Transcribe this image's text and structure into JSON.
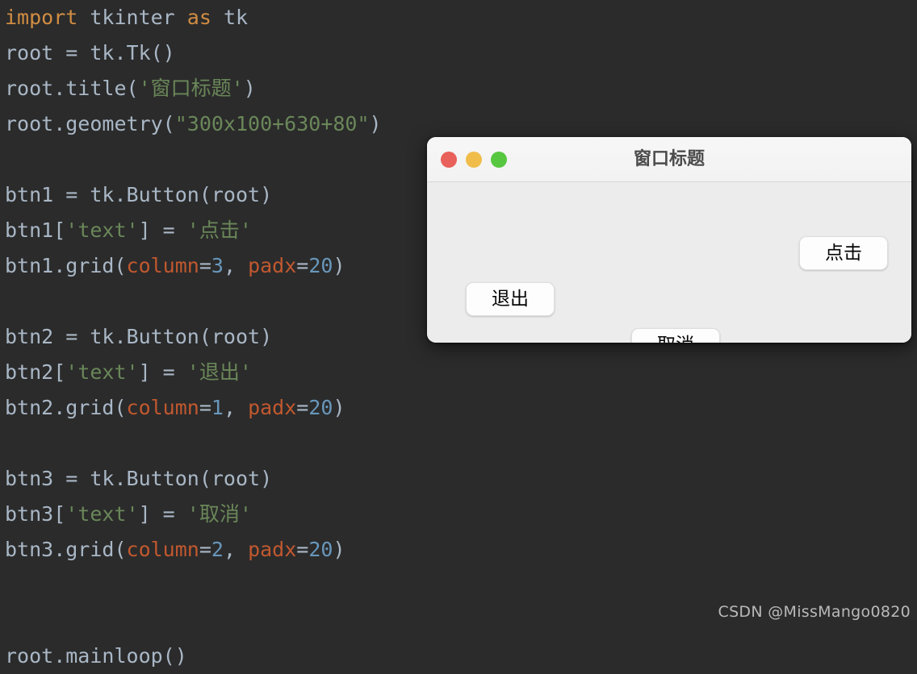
{
  "editor": {
    "background_color": "#2b2b2b",
    "default_text_color": "#a9b7c6",
    "keyword_color": "#d18d43",
    "string_color": "#6a8759",
    "kwarg_color": "#c1582f",
    "number_color": "#6897bb",
    "lines": [
      {
        "id": "l1",
        "parts": [
          {
            "t": "import",
            "c": "kw"
          },
          {
            "t": " tkinter ",
            "c": "plain"
          },
          {
            "t": "as",
            "c": "kw"
          },
          {
            "t": " tk",
            "c": "plain"
          }
        ]
      },
      {
        "id": "l2",
        "parts": [
          {
            "t": "root = tk.Tk()",
            "c": "plain"
          }
        ]
      },
      {
        "id": "l3",
        "parts": [
          {
            "t": "root.title(",
            "c": "plain"
          },
          {
            "t": "'窗口标题'",
            "c": "str"
          },
          {
            "t": ")",
            "c": "plain"
          }
        ]
      },
      {
        "id": "l4",
        "parts": [
          {
            "t": "root.geometry(",
            "c": "plain"
          },
          {
            "t": "\"300x100+630+80\"",
            "c": "str"
          },
          {
            "t": ")",
            "c": "plain"
          }
        ]
      },
      {
        "id": "l5",
        "parts": [
          {
            "t": "",
            "c": "plain"
          }
        ]
      },
      {
        "id": "l6",
        "parts": [
          {
            "t": "btn1 = tk.Button(root)",
            "c": "plain"
          }
        ]
      },
      {
        "id": "l7",
        "parts": [
          {
            "t": "btn1[",
            "c": "plain"
          },
          {
            "t": "'text'",
            "c": "str"
          },
          {
            "t": "] = ",
            "c": "plain"
          },
          {
            "t": "'点击'",
            "c": "str"
          }
        ]
      },
      {
        "id": "l8",
        "parts": [
          {
            "t": "btn1.grid(",
            "c": "plain"
          },
          {
            "t": "column",
            "c": "arg"
          },
          {
            "t": "=",
            "c": "plain"
          },
          {
            "t": "3",
            "c": "num"
          },
          {
            "t": ", ",
            "c": "plain"
          },
          {
            "t": "padx",
            "c": "arg"
          },
          {
            "t": "=",
            "c": "plain"
          },
          {
            "t": "20",
            "c": "num"
          },
          {
            "t": ")",
            "c": "plain"
          }
        ]
      },
      {
        "id": "l9",
        "parts": [
          {
            "t": "",
            "c": "plain"
          }
        ]
      },
      {
        "id": "l10",
        "parts": [
          {
            "t": "btn2 = tk.Button(root)",
            "c": "plain"
          }
        ]
      },
      {
        "id": "l11",
        "parts": [
          {
            "t": "btn2[",
            "c": "plain"
          },
          {
            "t": "'text'",
            "c": "str"
          },
          {
            "t": "] = ",
            "c": "plain"
          },
          {
            "t": "'退出'",
            "c": "str"
          }
        ]
      },
      {
        "id": "l12",
        "parts": [
          {
            "t": "btn2.grid(",
            "c": "plain"
          },
          {
            "t": "column",
            "c": "arg"
          },
          {
            "t": "=",
            "c": "plain"
          },
          {
            "t": "1",
            "c": "num"
          },
          {
            "t": ", ",
            "c": "plain"
          },
          {
            "t": "padx",
            "c": "arg"
          },
          {
            "t": "=",
            "c": "plain"
          },
          {
            "t": "20",
            "c": "num"
          },
          {
            "t": ")",
            "c": "plain"
          }
        ]
      },
      {
        "id": "l13",
        "parts": [
          {
            "t": "",
            "c": "plain"
          }
        ]
      },
      {
        "id": "l14",
        "parts": [
          {
            "t": "btn3 = tk.Button(root)",
            "c": "plain"
          }
        ]
      },
      {
        "id": "l15",
        "parts": [
          {
            "t": "btn3[",
            "c": "plain"
          },
          {
            "t": "'text'",
            "c": "str"
          },
          {
            "t": "] = ",
            "c": "plain"
          },
          {
            "t": "'取消'",
            "c": "str"
          }
        ]
      },
      {
        "id": "l16",
        "parts": [
          {
            "t": "btn3.grid(",
            "c": "plain"
          },
          {
            "t": "column",
            "c": "arg"
          },
          {
            "t": "=",
            "c": "plain"
          },
          {
            "t": "2",
            "c": "num"
          },
          {
            "t": ", ",
            "c": "plain"
          },
          {
            "t": "padx",
            "c": "arg"
          },
          {
            "t": "=",
            "c": "plain"
          },
          {
            "t": "20",
            "c": "num"
          },
          {
            "t": ")",
            "c": "plain"
          }
        ]
      },
      {
        "id": "l17",
        "parts": [
          {
            "t": "",
            "c": "plain"
          }
        ]
      },
      {
        "id": "l18",
        "parts": [
          {
            "t": "",
            "c": "plain"
          }
        ]
      },
      {
        "id": "l19",
        "parts": [
          {
            "t": "root.mainloop()",
            "c": "plain"
          }
        ]
      }
    ]
  },
  "tk_window": {
    "title": "窗口标题",
    "titlebar_color": "#f4f4f4",
    "body_color": "#ececec",
    "traffic_lights": [
      {
        "name": "close-button",
        "color": "#e8615a"
      },
      {
        "name": "minimize-button",
        "color": "#f0bd4b"
      },
      {
        "name": "zoom-button",
        "color": "#57c740"
      }
    ],
    "buttons": {
      "click": "点击",
      "quit": "退出",
      "cancel": "取消"
    }
  },
  "watermark": {
    "text": "CSDN @MissMango0820"
  }
}
